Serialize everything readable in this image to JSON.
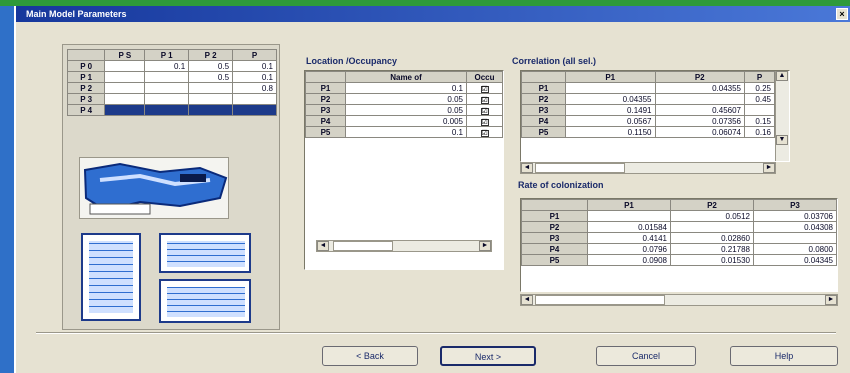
{
  "window": {
    "title": "Main Model Parameters",
    "close": "×"
  },
  "matrix": {
    "headers": [
      "",
      "P S",
      "P 1",
      "P 2",
      "P"
    ],
    "rows": [
      {
        "label": "P 0",
        "cells": [
          "",
          "0.1",
          "0.5",
          "0.1"
        ]
      },
      {
        "label": "P 1",
        "cells": [
          "",
          "",
          "0.5",
          "0.1"
        ]
      },
      {
        "label": "P 2",
        "cells": [
          "",
          "",
          "",
          "0.8"
        ]
      },
      {
        "label": "P 3",
        "cells": [
          "",
          "",
          "",
          ""
        ]
      },
      {
        "label": "P 4",
        "cells": [
          "",
          "",
          "",
          ""
        ]
      }
    ]
  },
  "location": {
    "title": "Location /Occupancy",
    "headers": [
      "",
      "Name of",
      "Occu"
    ],
    "rows": [
      {
        "label": "P1",
        "value": "0.1",
        "checked": "☑"
      },
      {
        "label": "P2",
        "value": "0.05",
        "checked": "☑"
      },
      {
        "label": "P3",
        "value": "0.05",
        "checked": "☑"
      },
      {
        "label": "P4",
        "value": "0.005",
        "checked": "☑"
      },
      {
        "label": "P5",
        "value": "0.1",
        "checked": "☑"
      }
    ]
  },
  "correlation": {
    "title": "Correlation (all sel.)",
    "headers": [
      "",
      "P1",
      "P2",
      "P"
    ],
    "rows": [
      {
        "label": "P1",
        "cells": [
          "",
          "0.04355",
          "0.25"
        ]
      },
      {
        "label": "P2",
        "cells": [
          "0.04355",
          "",
          "0.45"
        ]
      },
      {
        "label": "P3",
        "cells": [
          "0.1491",
          "0.45607",
          ""
        ]
      },
      {
        "label": "P4",
        "cells": [
          "0.0567",
          "0.07356",
          "0.15"
        ]
      },
      {
        "label": "P5",
        "cells": [
          "0.1150",
          "0.06074",
          "0.16"
        ]
      }
    ]
  },
  "rate": {
    "title": "Rate of colonization",
    "headers": [
      "",
      "P1",
      "P2",
      "P3"
    ],
    "rows": [
      {
        "label": "P1",
        "cells": [
          "",
          "0.0512",
          "0.03706"
        ]
      },
      {
        "label": "P2",
        "cells": [
          "0.01584",
          "",
          "0.04308"
        ]
      },
      {
        "label": "P3",
        "cells": [
          "0.4141",
          "0.02860",
          ""
        ]
      },
      {
        "label": "P4",
        "cells": [
          "0.0796",
          "0.21788",
          "0.0800"
        ]
      },
      {
        "label": "P5",
        "cells": [
          "0.0908",
          "0.01530",
          "0.04345"
        ]
      }
    ]
  },
  "scroll": {
    "left": "◄",
    "right": "►",
    "up": "▲",
    "down": "▼"
  },
  "buttons": {
    "back": "< Back",
    "next": "Next >",
    "cancel": "Cancel",
    "help": "Help"
  },
  "colors": {
    "title_bar": "#16379c",
    "selected_row": "#1d3a8a",
    "desktop_green": "#2e9a3a",
    "desktop_blue": "#2f70c8"
  }
}
